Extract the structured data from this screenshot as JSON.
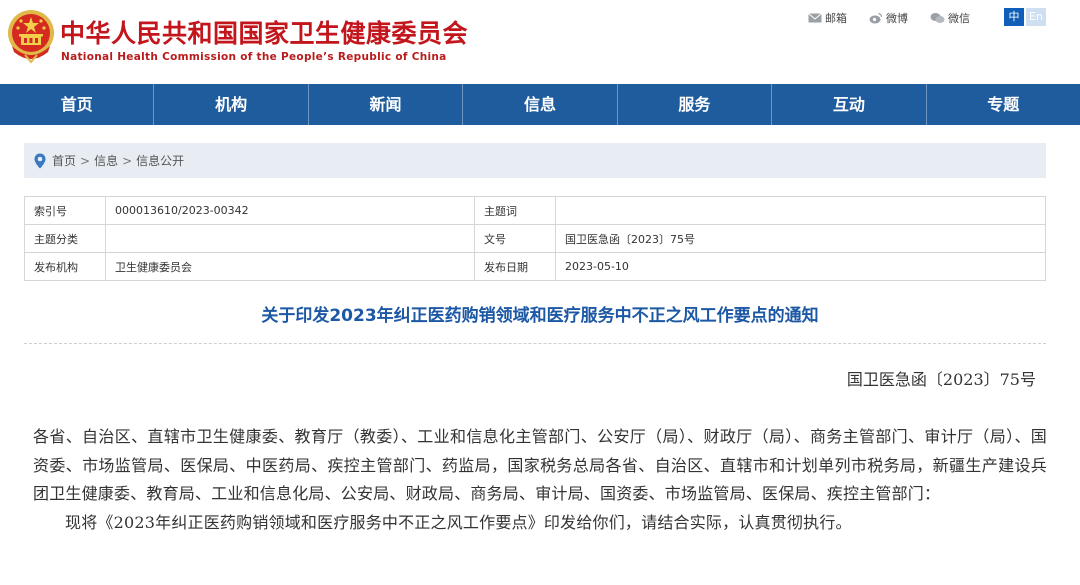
{
  "header": {
    "title": "中华人民共和国国家卫生健康委员会",
    "subtitle": "National Health Commission of the People’s Republic of China",
    "links": [
      {
        "label": "邮箱",
        "icon": "mail-icon"
      },
      {
        "label": "微博",
        "icon": "weibo-icon"
      },
      {
        "label": "微信",
        "icon": "wechat-icon"
      }
    ],
    "lang_zh": "中",
    "lang_en": "En"
  },
  "nav": [
    "首页",
    "机构",
    "新闻",
    "信息",
    "服务",
    "互动",
    "专题"
  ],
  "breadcrumb": [
    "首页",
    "信息",
    "信息公开"
  ],
  "breadcrumb_sep": ">",
  "info": {
    "index_label": "索引号",
    "index_value": "000013610/2023-00342",
    "topic_label": "主题词",
    "topic_value": "",
    "category_label": "主题分类",
    "category_value": "",
    "docno_label": "文号",
    "docno_value": "国卫医急函〔2023〕75号",
    "org_label": "发布机构",
    "org_value": "卫生健康委员会",
    "date_label": "发布日期",
    "date_value": "2023-05-10"
  },
  "document": {
    "title": "关于印发2023年纠正医药购销领域和医疗服务中不正之风工作要点的通知",
    "number": "国卫医急函〔2023〕75号",
    "addressees": "各省、自治区、直辖市卫生健康委、教育厅（教委）、工业和信息化主管部门、公安厅（局）、财政厅（局）、商务主管部门、审计厅（局）、国资委、市场监管局、医保局、中医药局、疾控主管部门、药监局，国家税务总局各省、自治区、直辖市和计划单列市税务局，新疆生产建设兵团卫生健康委、教育局、工业和信息化局、公安局、财政局、商务局、审计局、国资委、市场监管局、医保局、疾控主管部门：",
    "paragraph1": "现将《2023年纠正医药购销领域和医疗服务中不正之风工作要点》印发给你们，请结合实际，认真贯彻执行。"
  },
  "colors": {
    "brand_red": "#c2161c",
    "nav_blue": "#1f5c9d",
    "title_blue": "#1d58a5"
  }
}
